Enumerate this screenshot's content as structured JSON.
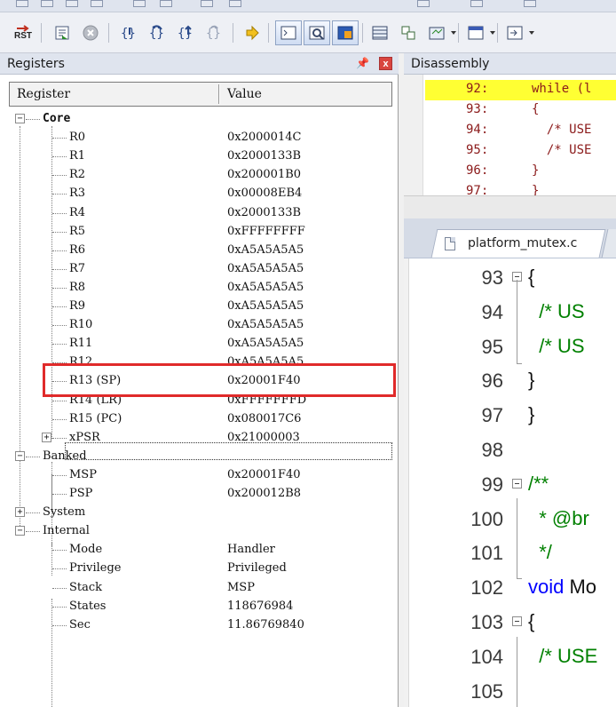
{
  "toolbar": {
    "reset_label": "RST",
    "buttons": [
      "reset-cpu",
      "run-to-cursor",
      "stop",
      "step",
      "step-over",
      "step-out",
      "run-to-cursor-line",
      "show-next-statement",
      "command-window",
      "disassembly-window",
      "symbols-window",
      "registers-window",
      "call-stack-window",
      "watch-window",
      "memory-window",
      "serial-window"
    ]
  },
  "registers_panel": {
    "title": "Registers",
    "pin": "↔",
    "close": "x",
    "columns": [
      "Register",
      "Value"
    ],
    "groups": {
      "core": "Core",
      "banked": "Banked",
      "system": "System",
      "internal": "Internal"
    },
    "core": [
      {
        "name": "R0",
        "value": "0x2000014C"
      },
      {
        "name": "R1",
        "value": "0x2000133B"
      },
      {
        "name": "R2",
        "value": "0x200001B0"
      },
      {
        "name": "R3",
        "value": "0x00008EB4"
      },
      {
        "name": "R4",
        "value": "0x2000133B"
      },
      {
        "name": "R5",
        "value": "0xFFFFFFFF"
      },
      {
        "name": "R6",
        "value": "0xA5A5A5A5"
      },
      {
        "name": "R7",
        "value": "0xA5A5A5A5"
      },
      {
        "name": "R8",
        "value": "0xA5A5A5A5"
      },
      {
        "name": "R9",
        "value": "0xA5A5A5A5"
      },
      {
        "name": "R10",
        "value": "0xA5A5A5A5"
      },
      {
        "name": "R11",
        "value": "0xA5A5A5A5"
      },
      {
        "name": "R12",
        "value": "0xA5A5A5A5"
      },
      {
        "name": "R13 (SP)",
        "value": "0x20001F40"
      },
      {
        "name": "R14 (LR)",
        "value": "0xFFFFFFFD"
      },
      {
        "name": "R15 (PC)",
        "value": "0x080017C6"
      },
      {
        "name": "xPSR",
        "value": "0x21000003"
      }
    ],
    "banked": [
      {
        "name": "MSP",
        "value": "0x20001F40"
      },
      {
        "name": "PSP",
        "value": "0x200012B8"
      }
    ],
    "internal": [
      {
        "name": "Mode",
        "value": "Handler"
      },
      {
        "name": "Privilege",
        "value": "Privileged"
      },
      {
        "name": "Stack",
        "value": "MSP"
      },
      {
        "name": "States",
        "value": "118676984"
      },
      {
        "name": "Sec",
        "value": "11.86769840"
      }
    ],
    "expander_open": "−",
    "expander_closed": "+"
  },
  "disassembly": {
    "title": "Disassembly",
    "lines": [
      {
        "num": "92:",
        "code": "while (l"
      },
      {
        "num": "93:",
        "code": "{"
      },
      {
        "num": "94:",
        "code": "  /* USE"
      },
      {
        "num": "95:",
        "code": "  /* USE"
      },
      {
        "num": "96:",
        "code": "}"
      },
      {
        "num": "97:",
        "code": "}"
      }
    ]
  },
  "editor": {
    "tab_label": "platform_mutex.c",
    "lines": [
      {
        "num": "93",
        "code": "{"
      },
      {
        "num": "94",
        "code": "  /* US"
      },
      {
        "num": "95",
        "code": "  /* US"
      },
      {
        "num": "96",
        "code": "}"
      },
      {
        "num": "97",
        "code": "}"
      },
      {
        "num": "98",
        "code": ""
      },
      {
        "num": "99",
        "code": "/**"
      },
      {
        "num": "100",
        "code": "  * @br"
      },
      {
        "num": "101",
        "code": "  */"
      },
      {
        "num": "102",
        "code_kw": "void",
        "code": " Mo"
      },
      {
        "num": "103",
        "code": "{"
      },
      {
        "num": "104",
        "code": "  /* USE"
      },
      {
        "num": "105",
        "code": ""
      }
    ]
  },
  "colors": {
    "highlight_box": "#e02a2a",
    "current_line": "#ffff33",
    "comment": "#008000",
    "keyword": "#0000ff"
  }
}
